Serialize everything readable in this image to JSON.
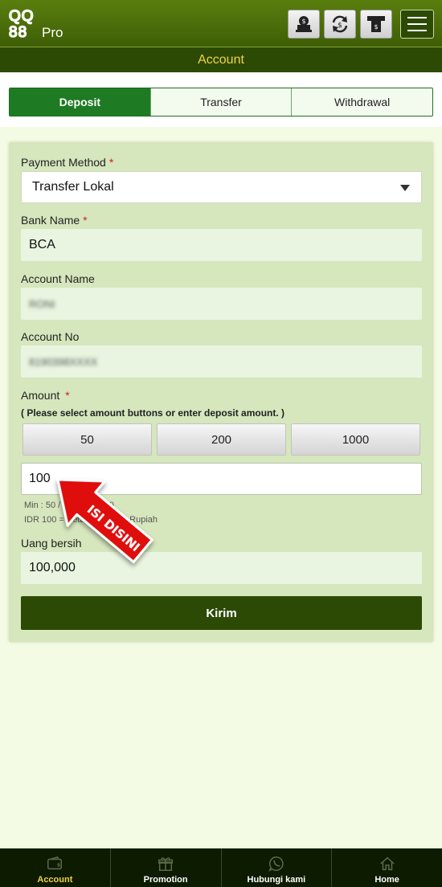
{
  "logo": {
    "line1": "QQ",
    "line2": "88",
    "suffix": "Pro"
  },
  "header": {
    "buttons": [
      {
        "name": "deposit-icon"
      },
      {
        "name": "transfer-icon"
      },
      {
        "name": "withdraw-icon"
      }
    ]
  },
  "page_title": "Account",
  "tabs": [
    {
      "label": "Deposit",
      "active": true
    },
    {
      "label": "Transfer",
      "active": false
    },
    {
      "label": "Withdrawal",
      "active": false
    }
  ],
  "form": {
    "payment_method": {
      "label": "Payment Method",
      "required": "*",
      "value": "Transfer Lokal"
    },
    "bank_name": {
      "label": "Bank Name",
      "required": "*",
      "value": "BCA"
    },
    "account_name": {
      "label": "Account Name",
      "value": "RONI"
    },
    "account_no": {
      "label": "Account No",
      "value": "8190398XXXX"
    },
    "amount": {
      "label": "Amount",
      "required": "*",
      "hint": "( Please select amount buttons or enter deposit amount. )",
      "buttons": [
        "50",
        "200",
        "1000"
      ],
      "value": "100",
      "min_note": "Min : 50 / Max : 50,000",
      "rate_note": "IDR 100 = Setara 100,000 Rupiah"
    },
    "net": {
      "label": "Uang bersih",
      "value": "100,000"
    },
    "submit_label": "Kirim"
  },
  "annotation": {
    "text": "ISI DISINI",
    "color": "#e01010"
  },
  "bottom_nav": [
    {
      "label": "Account",
      "icon": "wallet-icon",
      "active": true
    },
    {
      "label": "Promotion",
      "icon": "gift-icon",
      "active": false
    },
    {
      "label": "Hubungi kami",
      "icon": "whatsapp-icon",
      "active": false
    },
    {
      "label": "Home",
      "icon": "home-icon",
      "active": false
    }
  ],
  "colors": {
    "header": "#4a6b08",
    "accent": "#f2d24b",
    "tab_active": "#1f7a24",
    "submit": "#2d4a05"
  }
}
